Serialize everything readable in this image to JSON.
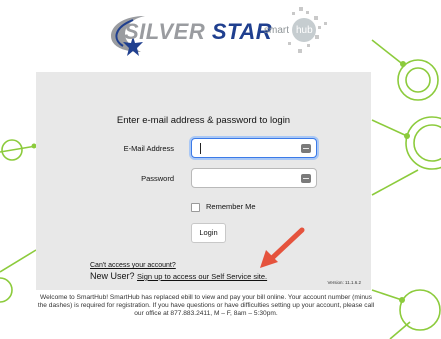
{
  "brand": {
    "word1": "SILVER",
    "word2": "STAR",
    "smarthub_text": "smart",
    "smarthub_hub": "hub"
  },
  "login": {
    "title": "Enter e-mail address & password to login",
    "email_label": "E-Mail Address",
    "email_value": "",
    "password_label": "Password",
    "password_value": "",
    "remember_label": "Remember Me",
    "remember_checked": false,
    "login_button": "Login",
    "cant_access_link": "Can't access your account?",
    "new_user_text": "New User?",
    "signup_link": "Sign up to access our Self Service site.",
    "version": "Version: 11.1.6.2"
  },
  "welcome": {
    "text": "Welcome to SmartHub! SmartHub has replaced ebill to view and pay your bill online. Your account number (minus the dashes) is required for registration. If you have questions or have difficulties setting up your account, please call our office at 877.883.2411, M – F, 8am – 5:30pm."
  },
  "colors": {
    "brand_navy": "#1f3f8f",
    "brand_silver": "#9a9ca0",
    "deco_green": "#8ccb3c",
    "arrow_red": "#e5533d",
    "focus_blue": "#3b7ae8"
  }
}
